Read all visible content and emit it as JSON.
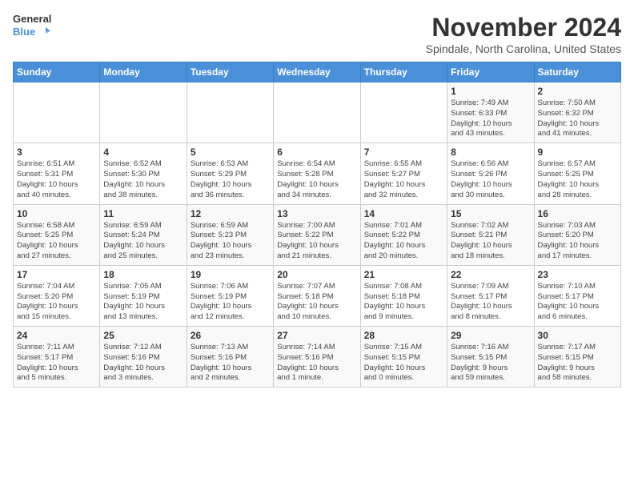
{
  "logo": {
    "line1": "General",
    "line2": "Blue"
  },
  "title": "November 2024",
  "location": "Spindale, North Carolina, United States",
  "weekdays": [
    "Sunday",
    "Monday",
    "Tuesday",
    "Wednesday",
    "Thursday",
    "Friday",
    "Saturday"
  ],
  "weeks": [
    [
      {
        "day": "",
        "info": ""
      },
      {
        "day": "",
        "info": ""
      },
      {
        "day": "",
        "info": ""
      },
      {
        "day": "",
        "info": ""
      },
      {
        "day": "",
        "info": ""
      },
      {
        "day": "1",
        "info": "Sunrise: 7:49 AM\nSunset: 6:33 PM\nDaylight: 10 hours\nand 43 minutes."
      },
      {
        "day": "2",
        "info": "Sunrise: 7:50 AM\nSunset: 6:32 PM\nDaylight: 10 hours\nand 41 minutes."
      }
    ],
    [
      {
        "day": "3",
        "info": "Sunrise: 6:51 AM\nSunset: 5:31 PM\nDaylight: 10 hours\nand 40 minutes."
      },
      {
        "day": "4",
        "info": "Sunrise: 6:52 AM\nSunset: 5:30 PM\nDaylight: 10 hours\nand 38 minutes."
      },
      {
        "day": "5",
        "info": "Sunrise: 6:53 AM\nSunset: 5:29 PM\nDaylight: 10 hours\nand 36 minutes."
      },
      {
        "day": "6",
        "info": "Sunrise: 6:54 AM\nSunset: 5:28 PM\nDaylight: 10 hours\nand 34 minutes."
      },
      {
        "day": "7",
        "info": "Sunrise: 6:55 AM\nSunset: 5:27 PM\nDaylight: 10 hours\nand 32 minutes."
      },
      {
        "day": "8",
        "info": "Sunrise: 6:56 AM\nSunset: 5:26 PM\nDaylight: 10 hours\nand 30 minutes."
      },
      {
        "day": "9",
        "info": "Sunrise: 6:57 AM\nSunset: 5:25 PM\nDaylight: 10 hours\nand 28 minutes."
      }
    ],
    [
      {
        "day": "10",
        "info": "Sunrise: 6:58 AM\nSunset: 5:25 PM\nDaylight: 10 hours\nand 27 minutes."
      },
      {
        "day": "11",
        "info": "Sunrise: 6:59 AM\nSunset: 5:24 PM\nDaylight: 10 hours\nand 25 minutes."
      },
      {
        "day": "12",
        "info": "Sunrise: 6:59 AM\nSunset: 5:23 PM\nDaylight: 10 hours\nand 23 minutes."
      },
      {
        "day": "13",
        "info": "Sunrise: 7:00 AM\nSunset: 5:22 PM\nDaylight: 10 hours\nand 21 minutes."
      },
      {
        "day": "14",
        "info": "Sunrise: 7:01 AM\nSunset: 5:22 PM\nDaylight: 10 hours\nand 20 minutes."
      },
      {
        "day": "15",
        "info": "Sunrise: 7:02 AM\nSunset: 5:21 PM\nDaylight: 10 hours\nand 18 minutes."
      },
      {
        "day": "16",
        "info": "Sunrise: 7:03 AM\nSunset: 5:20 PM\nDaylight: 10 hours\nand 17 minutes."
      }
    ],
    [
      {
        "day": "17",
        "info": "Sunrise: 7:04 AM\nSunset: 5:20 PM\nDaylight: 10 hours\nand 15 minutes."
      },
      {
        "day": "18",
        "info": "Sunrise: 7:05 AM\nSunset: 5:19 PM\nDaylight: 10 hours\nand 13 minutes."
      },
      {
        "day": "19",
        "info": "Sunrise: 7:06 AM\nSunset: 5:19 PM\nDaylight: 10 hours\nand 12 minutes."
      },
      {
        "day": "20",
        "info": "Sunrise: 7:07 AM\nSunset: 5:18 PM\nDaylight: 10 hours\nand 10 minutes."
      },
      {
        "day": "21",
        "info": "Sunrise: 7:08 AM\nSunset: 5:18 PM\nDaylight: 10 hours\nand 9 minutes."
      },
      {
        "day": "22",
        "info": "Sunrise: 7:09 AM\nSunset: 5:17 PM\nDaylight: 10 hours\nand 8 minutes."
      },
      {
        "day": "23",
        "info": "Sunrise: 7:10 AM\nSunset: 5:17 PM\nDaylight: 10 hours\nand 6 minutes."
      }
    ],
    [
      {
        "day": "24",
        "info": "Sunrise: 7:11 AM\nSunset: 5:17 PM\nDaylight: 10 hours\nand 5 minutes."
      },
      {
        "day": "25",
        "info": "Sunrise: 7:12 AM\nSunset: 5:16 PM\nDaylight: 10 hours\nand 3 minutes."
      },
      {
        "day": "26",
        "info": "Sunrise: 7:13 AM\nSunset: 5:16 PM\nDaylight: 10 hours\nand 2 minutes."
      },
      {
        "day": "27",
        "info": "Sunrise: 7:14 AM\nSunset: 5:16 PM\nDaylight: 10 hours\nand 1 minute."
      },
      {
        "day": "28",
        "info": "Sunrise: 7:15 AM\nSunset: 5:15 PM\nDaylight: 10 hours\nand 0 minutes."
      },
      {
        "day": "29",
        "info": "Sunrise: 7:16 AM\nSunset: 5:15 PM\nDaylight: 9 hours\nand 59 minutes."
      },
      {
        "day": "30",
        "info": "Sunrise: 7:17 AM\nSunset: 5:15 PM\nDaylight: 9 hours\nand 58 minutes."
      }
    ]
  ]
}
